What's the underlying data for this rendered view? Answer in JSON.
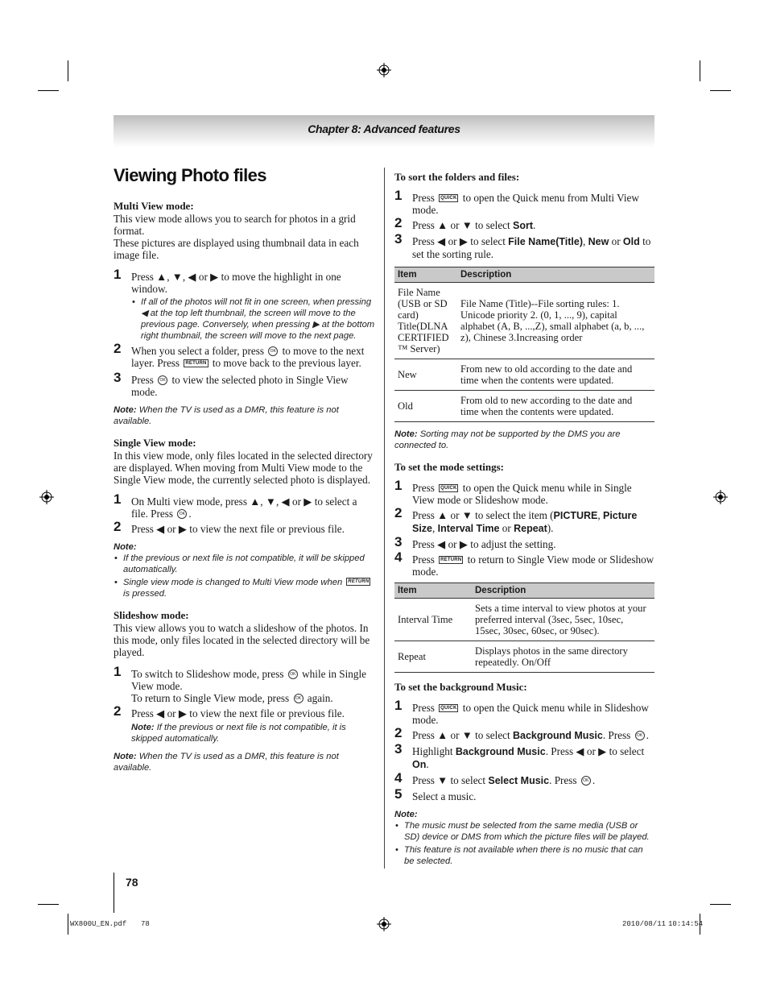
{
  "header": {
    "chapter": "Chapter 8: Advanced features"
  },
  "page_title": "Viewing Photo files",
  "left": {
    "multi_view": {
      "heading": "Multi View mode:",
      "intro1": "This view mode allows you to search for photos in a grid format.",
      "intro2": "These pictures are displayed using thumbnail data in each image file.",
      "step1": {
        "num": "1",
        "text": "Press ▲, ▼, ◀ or ▶ to move the highlight in one window."
      },
      "step1_bullet": "If all of the photos will not fit in one screen, when pressing ◀ at the top left thumbnail, the screen will move to the previous page. Conversely, when pressing ▶ at the bottom right thumbnail, the screen will move to the next page.",
      "step2": {
        "num": "2",
        "pre": "When you select a folder, press",
        "mid": "to move to the next layer. Press",
        "post": "to move back to the previous layer."
      },
      "step3": {
        "num": "3",
        "pre": "Press",
        "post": "to view the selected photo in Single View mode."
      },
      "note_label": "Note:",
      "note": "When the TV is used as a DMR, this feature is not available."
    },
    "single_view": {
      "heading": "Single View mode:",
      "intro": "In this view mode, only files located in the selected directory are displayed. When moving from Multi View mode to the Single View mode, the currently selected photo is displayed.",
      "step1": {
        "num": "1",
        "pre": "On Multi view mode, press ▲, ▼, ◀ or ▶ to select a file. Press",
        "post": "."
      },
      "step2": {
        "num": "2",
        "text": "Press ◀ or ▶ to view the next file or previous file."
      },
      "note_label": "Note:",
      "bullets": [
        "If the previous or next file is not compatible, it will be skipped automatically.",
        "Single view mode is changed to Multi View mode when",
        "is pressed."
      ]
    },
    "slideshow": {
      "heading": "Slideshow mode:",
      "intro": "This view allows you to watch a slideshow of the photos. In this mode, only files located in the selected directory will be played.",
      "step1": {
        "num": "1",
        "pre": "To switch to Slideshow mode, press",
        "post": "while in Single View mode.",
        "line2_pre": "To return to Single View mode, press",
        "line2_post": "again."
      },
      "step2": {
        "num": "2",
        "text": "Press ◀ or ▶ to view the next file or previous file."
      },
      "step2_note_label": "Note:",
      "step2_note": "If the previous or next file is not compatible, it is skipped automatically.",
      "note_label": "Note:",
      "note": "When the TV is used as a DMR, this feature is not available."
    }
  },
  "right": {
    "sort": {
      "heading": "To sort the folders and files:",
      "step1": {
        "num": "1",
        "pre": "Press",
        "post": "to open the Quick menu from Multi View mode."
      },
      "step2": {
        "num": "2",
        "pre": "Press ▲ or ▼ to select",
        "bold": "Sort",
        "post": "."
      },
      "step3": {
        "num": "3",
        "pre": "Press ◀ or ▶ to select",
        "b1": "File Name(Title)",
        "sep1": ", ",
        "b2": "New",
        "sep2": " or ",
        "b3": "Old",
        "post": " to set the sorting rule."
      },
      "table": {
        "headers": [
          "Item",
          "Description"
        ],
        "rows": [
          {
            "item": "File Name (USB or SD card) Title(DLNA CERTIFIED ™ Server)",
            "desc": "File Name (Title)--File sorting rules: 1. Unicode priority 2. (0, 1, ..., 9), capital alphabet (A, B, ...,Z), small alphabet (a, b, ..., z), Chinese 3.Increasing order"
          },
          {
            "item": "New",
            "desc": "From new to old according to the date and time when the contents were updated."
          },
          {
            "item": "Old",
            "desc": "From old to new according to the date and time when the contents were updated."
          }
        ]
      },
      "note_label": "Note:",
      "note": "Sorting may not be supported by the DMS you are connected to."
    },
    "mode": {
      "heading": "To set the mode settings:",
      "step1": {
        "num": "1",
        "pre": "Press",
        "post": "to open the Quick menu while in Single View mode or Slideshow mode."
      },
      "step2": {
        "num": "2",
        "pre": "Press ▲ or ▼ to select the item (",
        "b1": "PICTURE",
        "b2": "Picture Size",
        "b3": "Interval Time",
        "b4": "Repeat",
        "post": ")."
      },
      "step3": {
        "num": "3",
        "text": "Press ◀ or ▶ to adjust the setting."
      },
      "step4": {
        "num": "4",
        "pre": "Press",
        "post": "to return to Single View mode or Slideshow mode."
      },
      "table": {
        "headers": [
          "Item",
          "Description"
        ],
        "rows": [
          {
            "item": "Interval Time",
            "desc": "Sets a time interval to view photos at your preferred interval (3sec, 5sec, 10sec, 15sec, 30sec, 60sec, or 90sec)."
          },
          {
            "item": "Repeat",
            "desc": "Displays photos in the same directory repeatedly. On/Off"
          }
        ]
      }
    },
    "music": {
      "heading": "To set the background Music:",
      "step1": {
        "num": "1",
        "pre": "Press",
        "post": "to open the Quick menu while in Slideshow mode."
      },
      "step2": {
        "num": "2",
        "pre": "Press ▲ or ▼ to select",
        "bold": "Background Music",
        "post": ". Press"
      },
      "step3": {
        "num": "3",
        "pre": "Highlight",
        "bold": "Background Music",
        "mid": ". Press ◀ or ▶ to select",
        "bold2": "On",
        "post": "."
      },
      "step4": {
        "num": "4",
        "pre": "Press ▼ to select",
        "bold": "Select Music",
        "post": ". Press"
      },
      "step5": {
        "num": "5",
        "text": "Select a music."
      },
      "note_label": "Note:",
      "bullets": [
        "The music must be selected from the same media (USB or SD) device or DMS from which the picture files will be played.",
        "This feature is not available when there is no music that can be selected."
      ]
    }
  },
  "icons": {
    "quick": "QUICK",
    "return": "RETURN",
    "ok": "OK"
  },
  "page_number": "78",
  "footer": {
    "file": "WX800U_EN.pdf",
    "page": "78",
    "date": "2010/08/11",
    "time": "10:14:54"
  }
}
